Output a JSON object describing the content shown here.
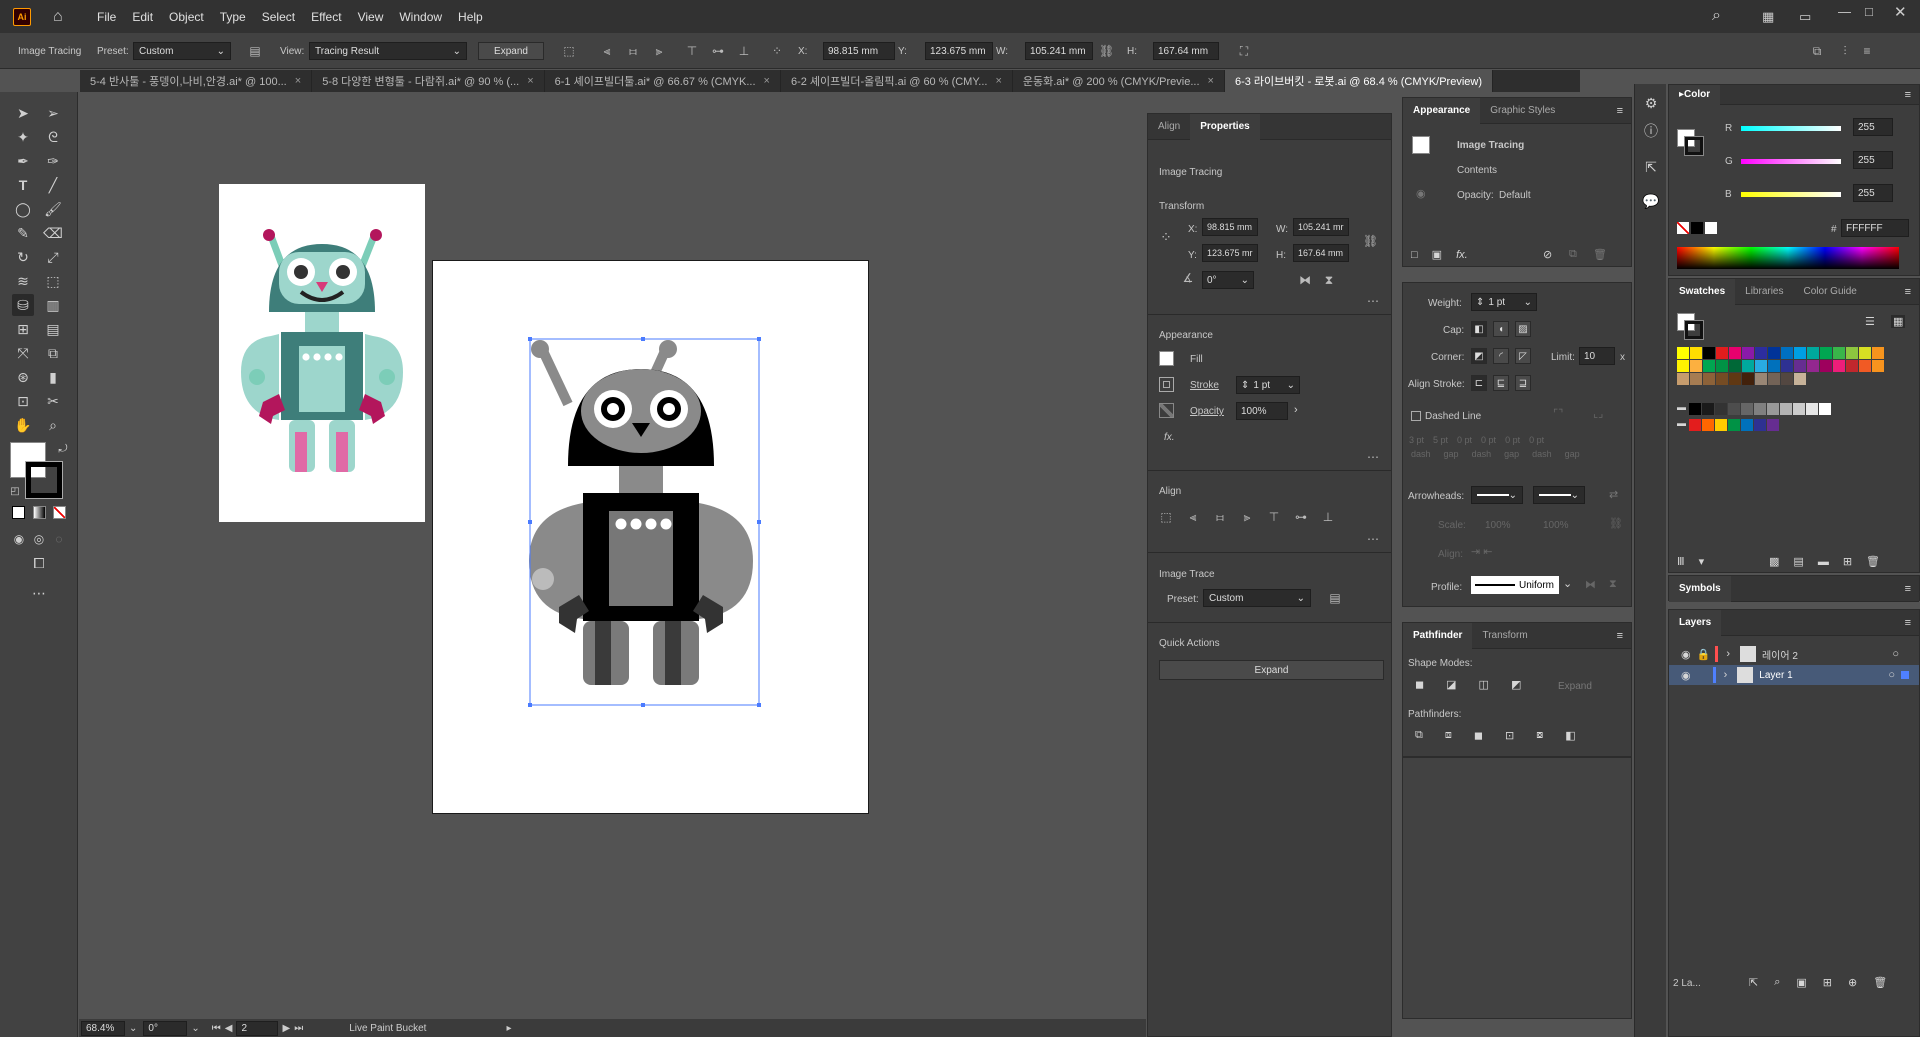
{
  "app": {
    "logo": "Ai",
    "menus": [
      "File",
      "Edit",
      "Object",
      "Type",
      "Select",
      "Effect",
      "View",
      "Window",
      "Help"
    ]
  },
  "control": {
    "mode": "Image Tracing",
    "preset_label": "Preset:",
    "preset_value": "Custom",
    "view_label": "View:",
    "view_value": "Tracing Result",
    "expand": "Expand",
    "x_label": "X:",
    "x": "98.815 mm",
    "y_label": "Y:",
    "y": "123.675 mm",
    "w_label": "W:",
    "w": "105.241 mm",
    "h_label": "H:",
    "h": "167.64 mm"
  },
  "tabs": [
    {
      "label": "5-4 반사툴 - 풍뎅이,나비,안경.ai* @ 100...",
      "close": "×"
    },
    {
      "label": "5-8 다양한 변형툴 - 다람쥐.ai* @ 90 % (...",
      "close": "×"
    },
    {
      "label": "6-1 셰이프빌더툴.ai* @ 66.67 % (CMYK...",
      "close": "×"
    },
    {
      "label": "6-2 셰이프빌더-올림픽.ai @ 60 % (CMY...",
      "close": "×"
    },
    {
      "label": "운동화.ai* @ 200 % (CMYK/Previe...",
      "close": "×"
    },
    {
      "label": "6-3 라이브버킷 - 로봇.ai @ 68.4 % (CMYK/Preview)",
      "close": ""
    }
  ],
  "status": {
    "zoom": "68.4%",
    "rotate": "0°",
    "artboard": "2",
    "tool": "Live Paint Bucket"
  },
  "properties": {
    "tabs": [
      "Align",
      "Properties"
    ],
    "object": "Image Tracing",
    "transform_title": "Transform",
    "x_label": "X:",
    "x": "98.815 mm",
    "y_label": "Y:",
    "y": "123.675 mr",
    "w_label": "W:",
    "w": "105.241 mr",
    "h_label": "H:",
    "h": "167.64 mm",
    "angle": "0°",
    "appearance_title": "Appearance",
    "fill": "Fill",
    "stroke": "Stroke",
    "stroke_value": "1 pt",
    "opacity": "Opacity",
    "opacity_value": "100%",
    "fx": "fx.",
    "align_title": "Align",
    "trace_title": "Image Trace",
    "preset_label": "Preset:",
    "preset_value": "Custom",
    "quick_title": "Quick Actions",
    "expand": "Expand"
  },
  "appearance": {
    "tabs": [
      "Appearance",
      "Graphic Styles"
    ],
    "item": "Image Tracing",
    "contents": "Contents",
    "opacity": "Opacity:",
    "opacity_value": "Default",
    "fx": "fx."
  },
  "stroke": {
    "weight_label": "Weight:",
    "weight": "1 pt",
    "cap_label": "Cap:",
    "corner_label": "Corner:",
    "limit_label": "Limit:",
    "limit": "10",
    "limit_unit": "x",
    "align_label": "Align Stroke:",
    "dashed": "Dashed Line",
    "dash_values": [
      "3 pt",
      "5 pt",
      "0 pt",
      "0 pt",
      "0 pt",
      "0 pt"
    ],
    "dash_labels": [
      "dash",
      "gap",
      "dash",
      "gap",
      "dash",
      "gap"
    ],
    "arrowheads_label": "Arrowheads:",
    "scale_label": "Scale:",
    "scale1": "100%",
    "scale2": "100%",
    "align2_label": "Align:",
    "profile_label": "Profile:",
    "profile": "Uniform"
  },
  "pathfinder": {
    "tabs": [
      "Pathfinder",
      "Transform"
    ],
    "shape_modes": "Shape Modes:",
    "expand": "Expand",
    "pathfinders": "Pathfinders:"
  },
  "color": {
    "title": "Color",
    "r_label": "R",
    "r": "255",
    "g_label": "G",
    "g": "255",
    "b_label": "B",
    "b": "255",
    "hash": "#",
    "hex": "FFFFFF"
  },
  "swatches": {
    "tabs": [
      "Swatches",
      "Libraries",
      "Color Guide"
    ],
    "row1": [
      "#ffff00",
      "#ffdd00",
      "#000000",
      "#e31d1d",
      "#e8006e",
      "#8a1aa8",
      "#2d2d9e",
      "#003399",
      "#0070c0",
      "#009fe3",
      "#00a99d",
      "#00a651",
      "#39b54a",
      "#8dc63f",
      "#d7df23",
      "#f7941d"
    ],
    "row2": [
      "#fff200",
      "#fcb040",
      "#00a651",
      "#009245",
      "#006837",
      "#00a99d",
      "#29abe2",
      "#0071bc",
      "#2e3192",
      "#662d91",
      "#93278f",
      "#9e005d",
      "#ed1e79",
      "#c1272d",
      "#f15a24",
      "#f7931e"
    ],
    "row3": [
      "#c69c6d",
      "#a67c52",
      "#8c6239",
      "#754c24",
      "#603813",
      "#42210b",
      "#998675",
      "#736357",
      "#534741",
      "#c7b299"
    ],
    "gray": [
      "#000000",
      "#1a1a1a",
      "#333333",
      "#4d4d4d",
      "#666666",
      "#808080",
      "#999999",
      "#b3b3b3",
      "#cccccc",
      "#e6e6e6",
      "#ffffff"
    ],
    "group": [
      "#e31d1d",
      "#ff6600",
      "#ffcc00",
      "#009245",
      "#0071bc",
      "#2e3192",
      "#662d91"
    ]
  },
  "symbols": {
    "title": "Symbols"
  },
  "layers": {
    "title": "Layers",
    "items": [
      {
        "name": "레이어 2",
        "color": "#ff4f4f"
      },
      {
        "name": "Layer 1",
        "color": "#4f80ff"
      }
    ],
    "count": "2 La..."
  }
}
